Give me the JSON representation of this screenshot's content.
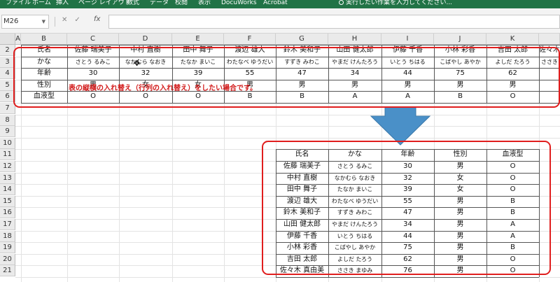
{
  "ribbon": {
    "tabs": [
      "ファイル",
      "ホーム",
      "挿入",
      "ページ レイアウト",
      "数式",
      "データ",
      "校閲",
      "表示",
      "DocuWorks",
      "Acrobat"
    ],
    "tell_me": "実行したい作業を入力してください..."
  },
  "formula_bar": {
    "name_box": "M26",
    "fx": "fx",
    "formula": ""
  },
  "columns": [
    "A",
    "B",
    "C",
    "D",
    "E",
    "F",
    "G",
    "H",
    "I",
    "J",
    "K"
  ],
  "rows": [
    "2",
    "3",
    "4",
    "5",
    "6",
    "7",
    "8",
    "9",
    "10",
    "11",
    "12",
    "13",
    "14",
    "15",
    "16",
    "17",
    "18",
    "19",
    "20",
    "21"
  ],
  "horizontal_table": {
    "labels": [
      "氏名",
      "かな",
      "年齢",
      "性別",
      "血液型"
    ],
    "people": [
      {
        "name": "佐藤 瑞美子",
        "kana": "さとう るみこ",
        "age": "30",
        "sex": "男",
        "blood": "O"
      },
      {
        "name": "中村 直樹",
        "kana": "なかむら なおき",
        "age": "32",
        "sex": "女",
        "blood": "O"
      },
      {
        "name": "田中 舞子",
        "kana": "たなか まいこ",
        "age": "39",
        "sex": "女",
        "blood": "O"
      },
      {
        "name": "渡辺 雄大",
        "kana": "わたなべ ゆうだい",
        "age": "55",
        "sex": "男",
        "blood": "B"
      },
      {
        "name": "鈴木 美和子",
        "kana": "すずき みわこ",
        "age": "47",
        "sex": "男",
        "blood": "B"
      },
      {
        "name": "山田 健太郎",
        "kana": "やまだ けんたろう",
        "age": "34",
        "sex": "男",
        "blood": "A"
      },
      {
        "name": "伊藤 千香",
        "kana": "いとう ちはる",
        "age": "44",
        "sex": "男",
        "blood": "A"
      },
      {
        "name": "小林 彩香",
        "kana": "こばやし あやか",
        "age": "75",
        "sex": "男",
        "blood": "B"
      },
      {
        "name": "吉田 太郎",
        "kana": "よしだ たろう",
        "age": "62",
        "sex": "男",
        "blood": "O"
      },
      {
        "name": "佐々木",
        "kana": "ささき"
      }
    ]
  },
  "note": "表の縦横の入れ替え（行列の入れ替え）をしたい場合です。",
  "vertical_table": {
    "headers": [
      "氏名",
      "かな",
      "年齢",
      "性別",
      "血液型"
    ],
    "rows": [
      [
        "佐藤 瑞美子",
        "さとう るみこ",
        "30",
        "男",
        "O"
      ],
      [
        "中村 直樹",
        "なかむら なおき",
        "32",
        "女",
        "O"
      ],
      [
        "田中 舞子",
        "たなか まいこ",
        "39",
        "女",
        "O"
      ],
      [
        "渡辺 雄大",
        "わたなべ ゆうだい",
        "55",
        "男",
        "B"
      ],
      [
        "鈴木 美和子",
        "すずき みわこ",
        "47",
        "男",
        "B"
      ],
      [
        "山田 健太郎",
        "やまだ けんたろう",
        "34",
        "男",
        "A"
      ],
      [
        "伊藤 千香",
        "いとう ちはる",
        "44",
        "男",
        "A"
      ],
      [
        "小林 彩香",
        "こばやし あやか",
        "75",
        "男",
        "B"
      ],
      [
        "吉田 太郎",
        "よしだ たろう",
        "62",
        "男",
        "O"
      ],
      [
        "佐々木 真由美",
        "ささき まゆみ",
        "76",
        "男",
        "O"
      ]
    ]
  },
  "colors": {
    "ribbon_green": "#217346",
    "highlight_red": "#e01e1e",
    "arrow_blue": "#4a90c8"
  },
  "icons": [
    "cancel-icon",
    "enter-check-icon",
    "function-icon",
    "lightbulb-icon",
    "cell-cursor-icon",
    "down-arrow-icon"
  ]
}
